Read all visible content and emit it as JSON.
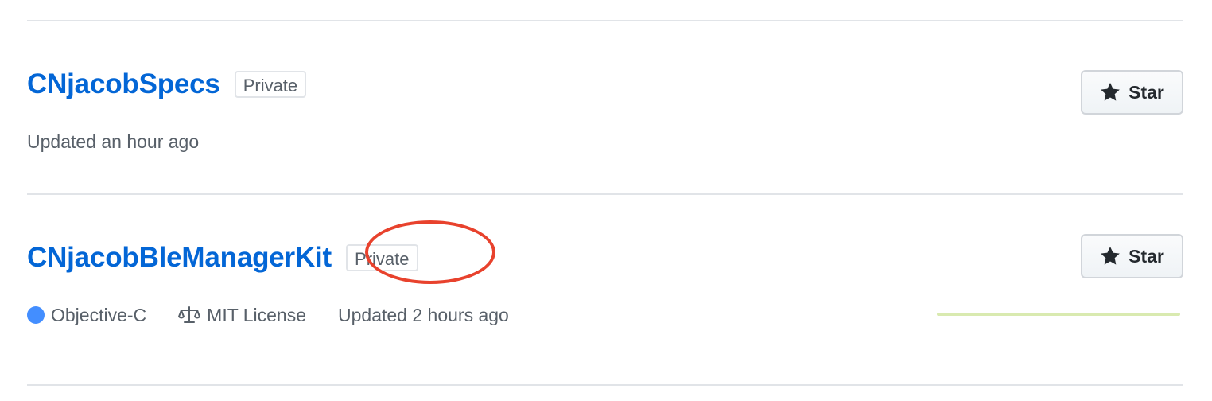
{
  "repos": [
    {
      "name": "CNjacobSpecs",
      "visibility": "Private",
      "updated": "Updated an hour ago",
      "star_label": "Star"
    },
    {
      "name": "CNjacobBleManagerKit",
      "visibility": "Private",
      "language": "Objective-C",
      "language_color": "#438eff",
      "license": "MIT License",
      "updated": "Updated 2 hours ago",
      "star_label": "Star",
      "activity_color": "#d9eab0"
    }
  ],
  "annotation": {
    "color": "#e8422d",
    "target": "private-badge"
  },
  "icons": {
    "star": "star-icon",
    "license": "law-icon"
  }
}
